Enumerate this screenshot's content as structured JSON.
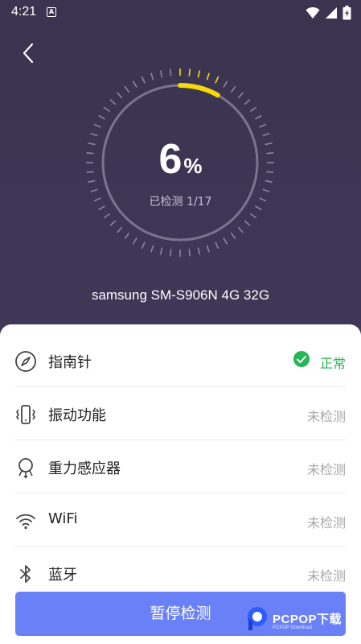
{
  "status_bar": {
    "time": "4:21",
    "a_badge": "A"
  },
  "gauge": {
    "percent": "6",
    "percent_sign": "%",
    "progress_fraction": 0.06,
    "progress_text": "已检测 1/17"
  },
  "device": {
    "name": "samsung SM-S906N 4G 32G"
  },
  "items": [
    {
      "label": "指南针",
      "status": "正常",
      "state": "ok"
    },
    {
      "label": "振动功能",
      "status": "未检测",
      "state": "pending"
    },
    {
      "label": "重力感应器",
      "status": "未检测",
      "state": "pending"
    },
    {
      "label": "WiFi",
      "status": "未检测",
      "state": "pending"
    },
    {
      "label": "蓝牙",
      "status": "未检测",
      "state": "pending"
    }
  ],
  "action": {
    "pause_label": "暂停检测"
  },
  "watermark": {
    "brand": "PCPOP下载",
    "sub": "PCPOP Download"
  },
  "colors": {
    "accent": "#6a80f7",
    "ok": "#26b557",
    "gauge_active": "#f5d90a",
    "header_bg": "#3c3653"
  }
}
